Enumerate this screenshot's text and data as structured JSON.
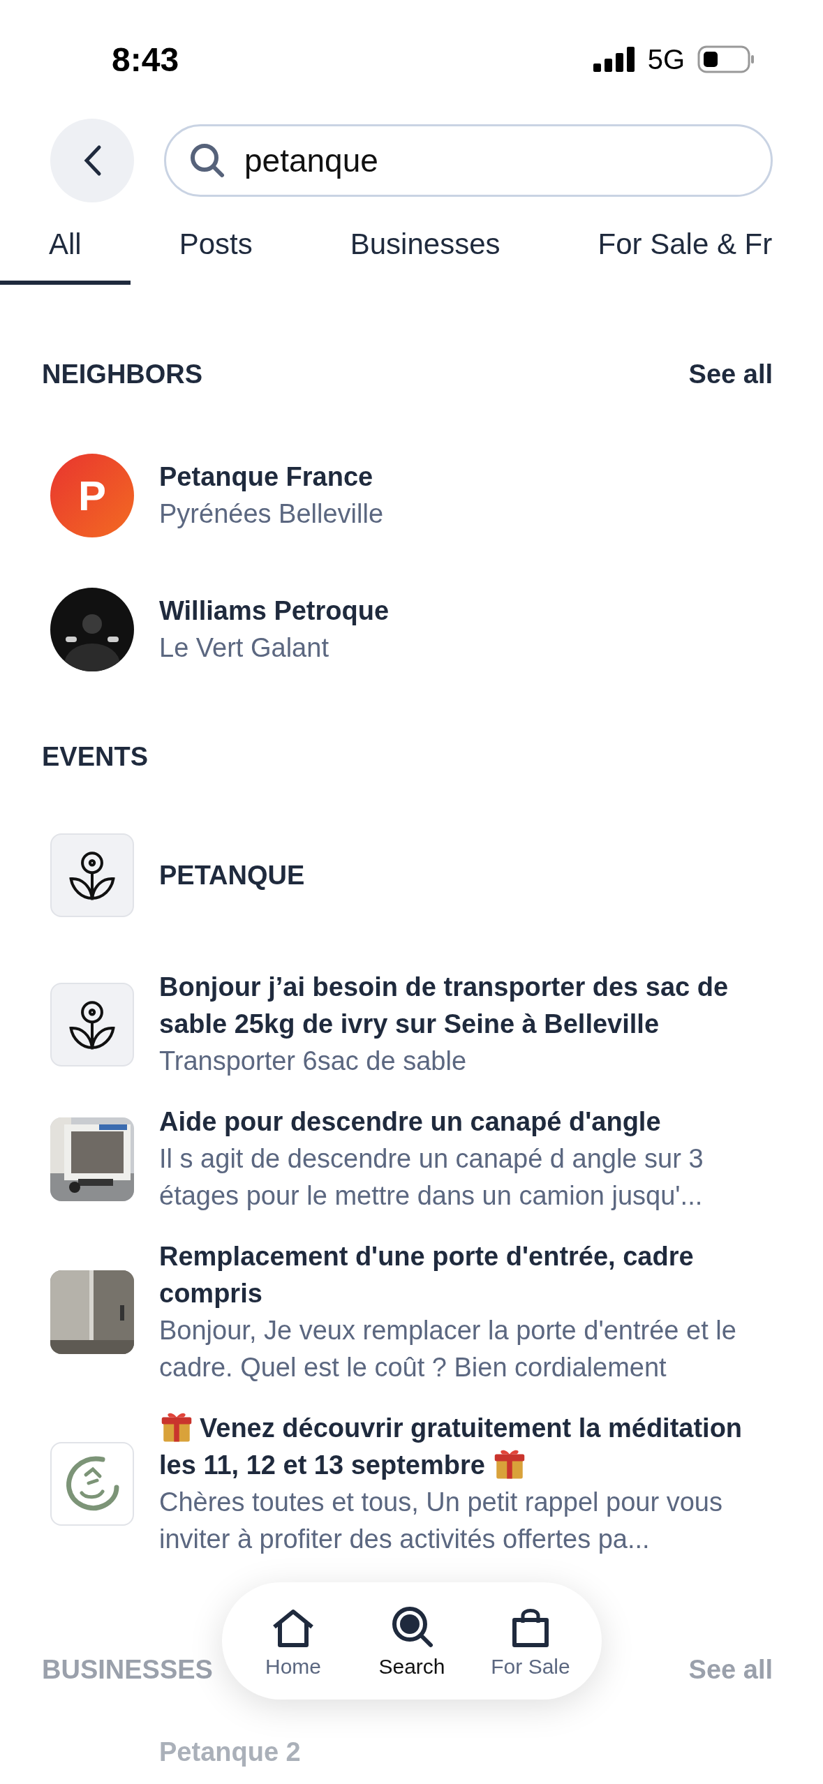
{
  "status_bar": {
    "time": "8:43",
    "network": "5G"
  },
  "search": {
    "value": "petanque"
  },
  "tabs": [
    {
      "label": "All",
      "selected": true
    },
    {
      "label": "Posts",
      "selected": false
    },
    {
      "label": "Businesses",
      "selected": false
    },
    {
      "label": "For Sale & Fr",
      "selected": false
    }
  ],
  "neighbors": {
    "heading": "NEIGHBORS",
    "see_all": "See all",
    "items": [
      {
        "name": "Petanque France",
        "location": "Pyrénées Belleville",
        "avatar": {
          "kind": "letter",
          "letter": "P"
        }
      },
      {
        "name": "Williams Petroque",
        "location": "Le Vert Galant"
      }
    ]
  },
  "events": {
    "heading": "EVENTS",
    "items": [
      {
        "kind": "flower",
        "title": "PETANQUE"
      },
      {
        "kind": "flower",
        "title": "Bonjour j’ai besoin de transporter des sac de sable 25kg de ivry sur Seine à Belleville",
        "description": "Transporter 6sac de sable"
      },
      {
        "title": "Aide pour descendre un canapé d'angle",
        "description": "Il s agit de descendre un canapé d angle sur 3 étages pour le mettre dans un camion  jusqu'..."
      },
      {
        "title": "Remplacement d'une porte d'entrée, cadre compris",
        "description": "Bonjour,   Je veux remplacer la porte d'entrée et le cadre.   Quel est le coût ?  Bien cordialement"
      },
      {
        "kind": "gift",
        "title": "Venez découvrir gratuitement la méditation les 11, 12 et 13 septembre",
        "description": "Chères toutes et tous, Un petit rappel pour vous inviter à profiter des activités offertes pa..."
      }
    ]
  },
  "businesses": {
    "heading": "BUSINESSES",
    "see_all": "See all",
    "items": [
      {
        "name": "Petanque 2"
      }
    ]
  },
  "bottom_nav": [
    {
      "label": "Home",
      "selected": false
    },
    {
      "label": "Search",
      "selected": true
    },
    {
      "label": "For Sale",
      "selected": false
    }
  ]
}
